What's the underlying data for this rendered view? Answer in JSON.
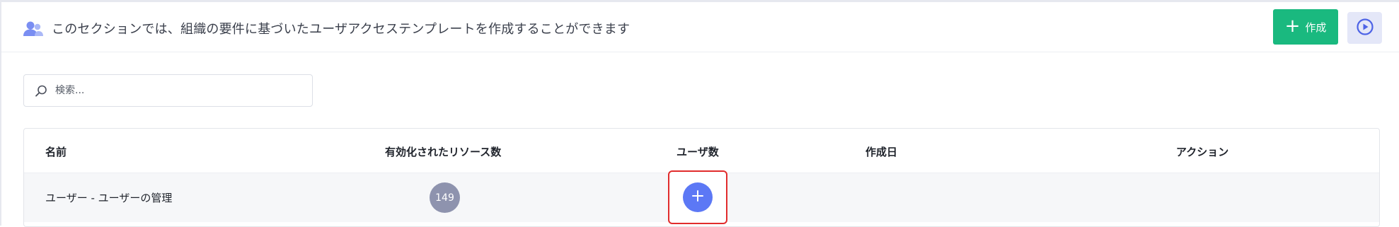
{
  "header": {
    "title": "このセクションでは、組織の要件に基づいたユーザアクセステンプレートを作成することができます",
    "icon": "users-icon",
    "create_button_label": "作成",
    "create_button_icon": "plus-icon",
    "play_button_icon": "play-circle-icon"
  },
  "search": {
    "placeholder": "検索...",
    "value": "",
    "icon": "search-icon"
  },
  "table": {
    "columns": [
      "名前",
      "有効化されたリソース数",
      "ユーザ数",
      "作成日",
      "アクション"
    ],
    "rows": [
      {
        "name": "ユーザー - ユーザーの管理",
        "resources": "149",
        "users_action_icon": "plus-icon",
        "created": "",
        "actions": ""
      }
    ]
  },
  "colors": {
    "primary_green": "#1ab97f",
    "accent_blue": "#5c78f5",
    "badge_gray": "#8e93ae",
    "highlight_red": "#e12c2c",
    "play_bg": "#e4e7f8"
  }
}
